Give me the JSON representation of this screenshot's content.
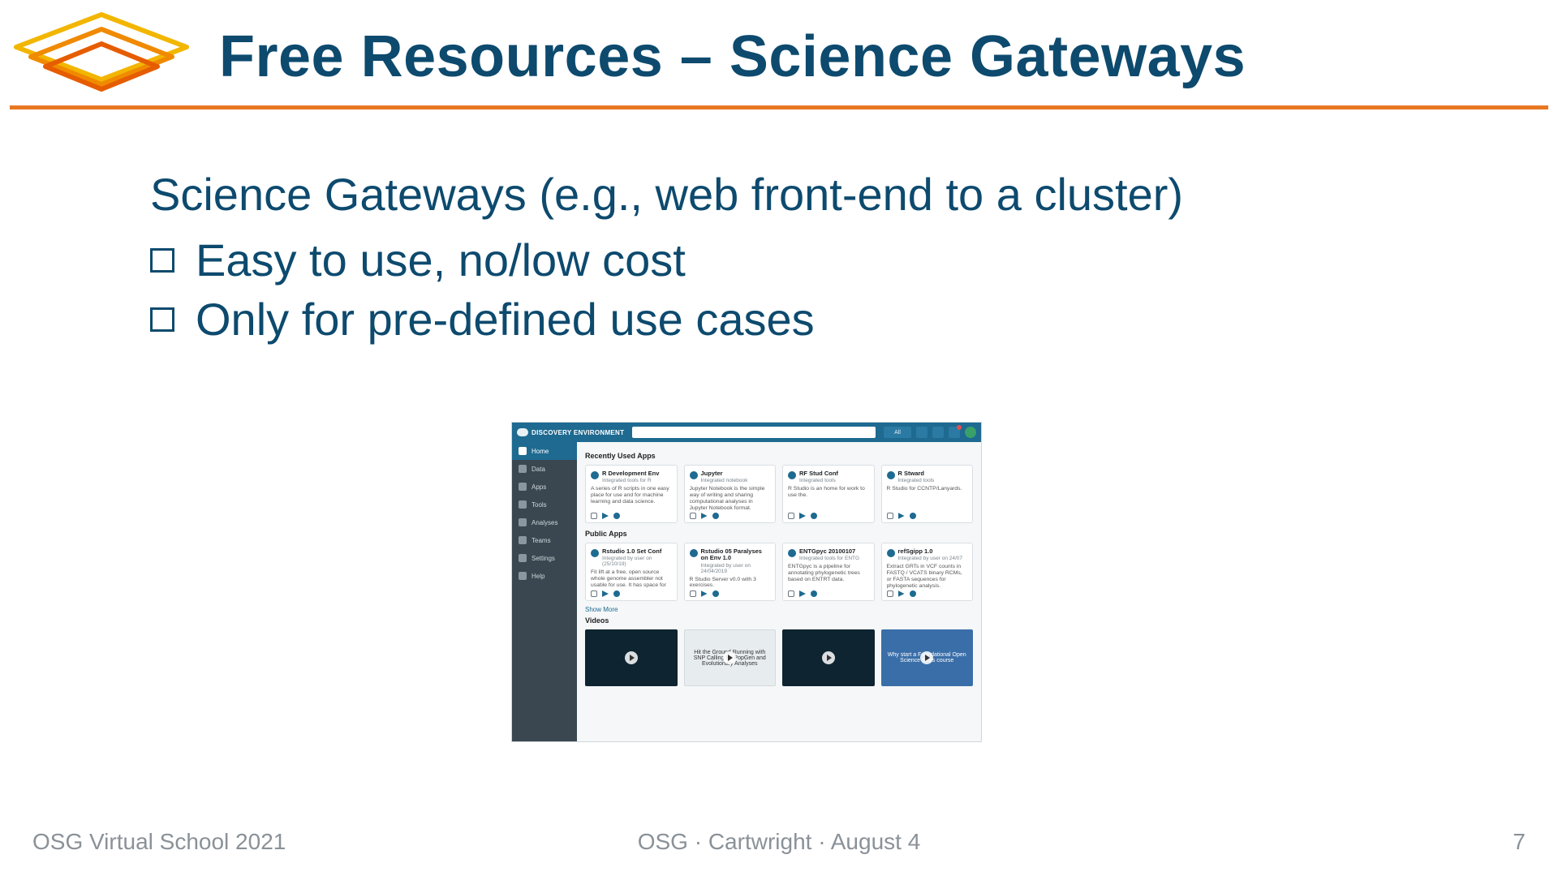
{
  "header": {
    "title": "Free Resources – Science Gateways"
  },
  "body": {
    "lead": "Science Gateways (e.g., web front-end to a cluster)",
    "bullets": [
      "Easy to use, no/low cost",
      "Only for pre-defined use cases"
    ]
  },
  "screenshot": {
    "brand": "DISCOVERY ENVIRONMENT",
    "search_placeholder": "",
    "filter_label": "All",
    "sidebar": [
      {
        "label": "Home",
        "active": true
      },
      {
        "label": "Data",
        "active": false
      },
      {
        "label": "Apps",
        "active": false
      },
      {
        "label": "Tools",
        "active": false
      },
      {
        "label": "Analyses",
        "active": false
      },
      {
        "label": "Teams",
        "active": false
      },
      {
        "label": "Settings",
        "active": false
      },
      {
        "label": "Help",
        "active": false
      }
    ],
    "section_recent": "Recently Used Apps",
    "section_public": "Public Apps",
    "show_more": "Show More",
    "section_videos": "Videos",
    "recent_apps": [
      {
        "title": "R Development Env",
        "meta": "Integrated tools for R",
        "desc": "A series of R scripts in one easy place for use and for machine learning and data science."
      },
      {
        "title": "Jupyter",
        "meta": "Integrated notebook",
        "desc": "Jupyter Notebook is the simple way of writing and sharing computational analyses in Jupyter Notebook format."
      },
      {
        "title": "RF Stud Conf",
        "meta": "Integrated tools",
        "desc": "R Studio is an home for work to use the."
      },
      {
        "title": "R Stward",
        "meta": "Integrated tools",
        "desc": "R Studio for CCNTP/Lanyards."
      }
    ],
    "public_apps": [
      {
        "title": "Rstudio 1.0 Set Conf",
        "meta": "Integrated by user on (25/10/19)",
        "desc": "Fit lift at a free, open source whole genome assembler not usable for use. It has space for the left in a series of raw large-scale analyses…"
      },
      {
        "title": "Rstudio 05 Paralyses on Env 1.0",
        "meta": "Integrated by user on 24/04/2019",
        "desc": "R Studio Server v0.0 with 3 exercises."
      },
      {
        "title": "ENTGpyc 20100107",
        "meta": "Integrated tools for ENTG",
        "desc": "ENTGpyc is a pipeline for annotating phylogenetic trees based on ENTRT data."
      },
      {
        "title": "refSgipp 1.0",
        "meta": "Integrated by user on 24/07",
        "desc": "Extract GRTs in VCF counts in FASTQ / VCATS binary RCMs, or FASTA sequences for phylogenetic analysis."
      }
    ],
    "videos": [
      {
        "caption": ""
      },
      {
        "caption": "Hit the Ground Running with SNP Calling for PopGen and Evolutionary Analyses"
      },
      {
        "caption": ""
      },
      {
        "caption": "Why start a Foundational Open Science Skills course"
      }
    ]
  },
  "footer": {
    "left": "OSG Virtual School 2021",
    "center": "OSG  ·  Cartwright  ·  August 4",
    "right": "7"
  }
}
